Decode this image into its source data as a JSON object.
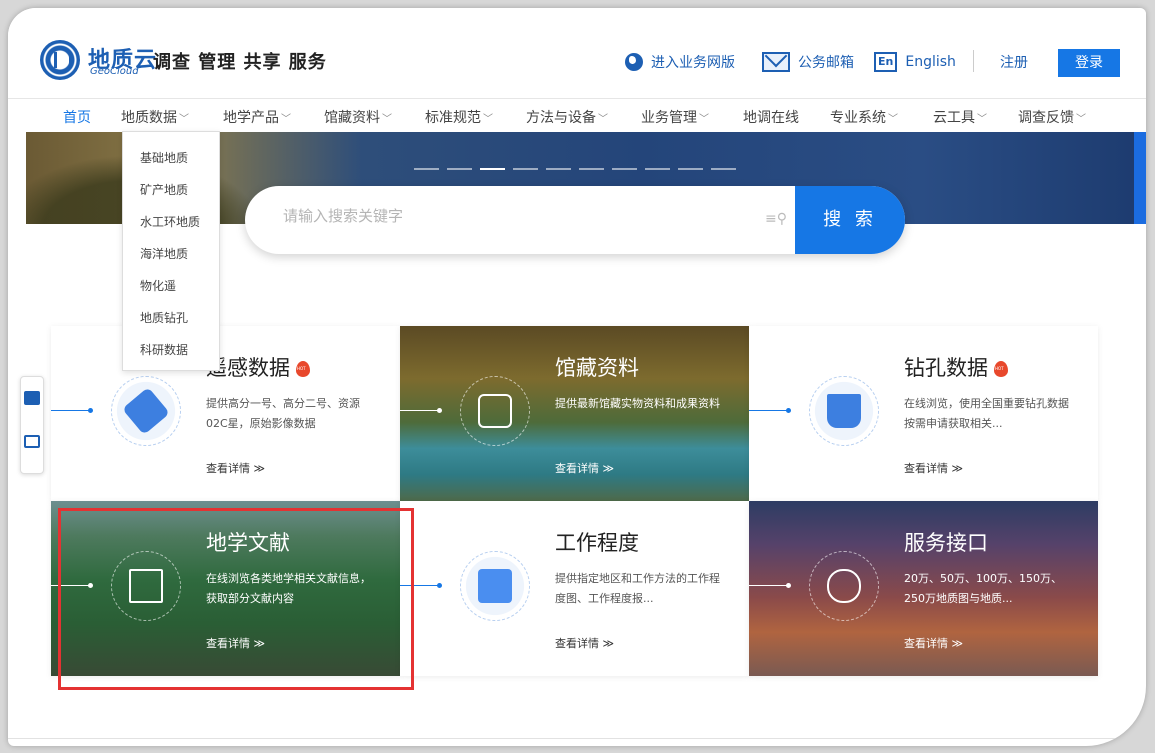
{
  "header": {
    "brand": "地质云",
    "brand_sub": "GeoCloud",
    "tagline": "调查 管理 共享 服务",
    "business_link": "进入业务网版",
    "mail_link": "公务邮箱",
    "en_badge": "En",
    "english_link": "English",
    "register": "注册",
    "login": "登录"
  },
  "nav": {
    "items": [
      {
        "label": "首页",
        "chevron": ""
      },
      {
        "label": "地质数据",
        "chevron": "﹀"
      },
      {
        "label": "地学产品",
        "chevron": "﹀"
      },
      {
        "label": "馆藏资料",
        "chevron": "﹀"
      },
      {
        "label": "标准规范",
        "chevron": "﹀"
      },
      {
        "label": "方法与设备",
        "chevron": "﹀"
      },
      {
        "label": "业务管理",
        "chevron": "﹀"
      },
      {
        "label": "地调在线",
        "chevron": ""
      },
      {
        "label": "专业系统",
        "chevron": "﹀"
      },
      {
        "label": "云工具",
        "chevron": "﹀"
      },
      {
        "label": "调查反馈",
        "chevron": "﹀"
      }
    ]
  },
  "dropdown": {
    "items": [
      "基础地质",
      "矿产地质",
      "水工环地质",
      "海洋地质",
      "物化遥",
      "地质钻孔",
      "科研数据"
    ]
  },
  "search": {
    "placeholder": "请输入搜索关键字",
    "button": "搜 索",
    "filter_icon": "≡⚲"
  },
  "cards": [
    {
      "title": "遥感数据",
      "hot": true,
      "desc": "提供高分一号、高分二号、资源02C星，原始影像数据",
      "more": "查看详情 ≫",
      "icon": "satellite-icon"
    },
    {
      "title": "馆藏资料",
      "hot": false,
      "desc": "提供最新馆藏实物资料和成果资料",
      "more": "查看详情 ≫",
      "icon": "archive-shelf-icon"
    },
    {
      "title": "钻孔数据",
      "hot": true,
      "desc": "在线浏览，使用全国重要钻孔数据按需申请获取相关...",
      "more": "查看详情 ≫",
      "icon": "drill-rig-icon"
    },
    {
      "title": "地学文献",
      "hot": false,
      "desc": "在线浏览各类地学相关文献信息，获取部分文献内容",
      "more": "查看详情 ≫",
      "icon": "open-book-icon"
    },
    {
      "title": "工作程度",
      "hot": false,
      "desc": "提供指定地区和工作方法的工作程度图、工作程度报...",
      "more": "查看详情 ≫",
      "icon": "chart-screen-icon"
    },
    {
      "title": "服务接口",
      "hot": false,
      "desc": "20万、50万、100万、150万、250万地质图与地质...",
      "more": "查看详情 ≫",
      "icon": "cloud-doc-icon"
    }
  ],
  "colors": {
    "primary": "#1677e5",
    "brand": "#1d5fb3",
    "highlight": "#e43232",
    "hot": "#e8482c"
  }
}
